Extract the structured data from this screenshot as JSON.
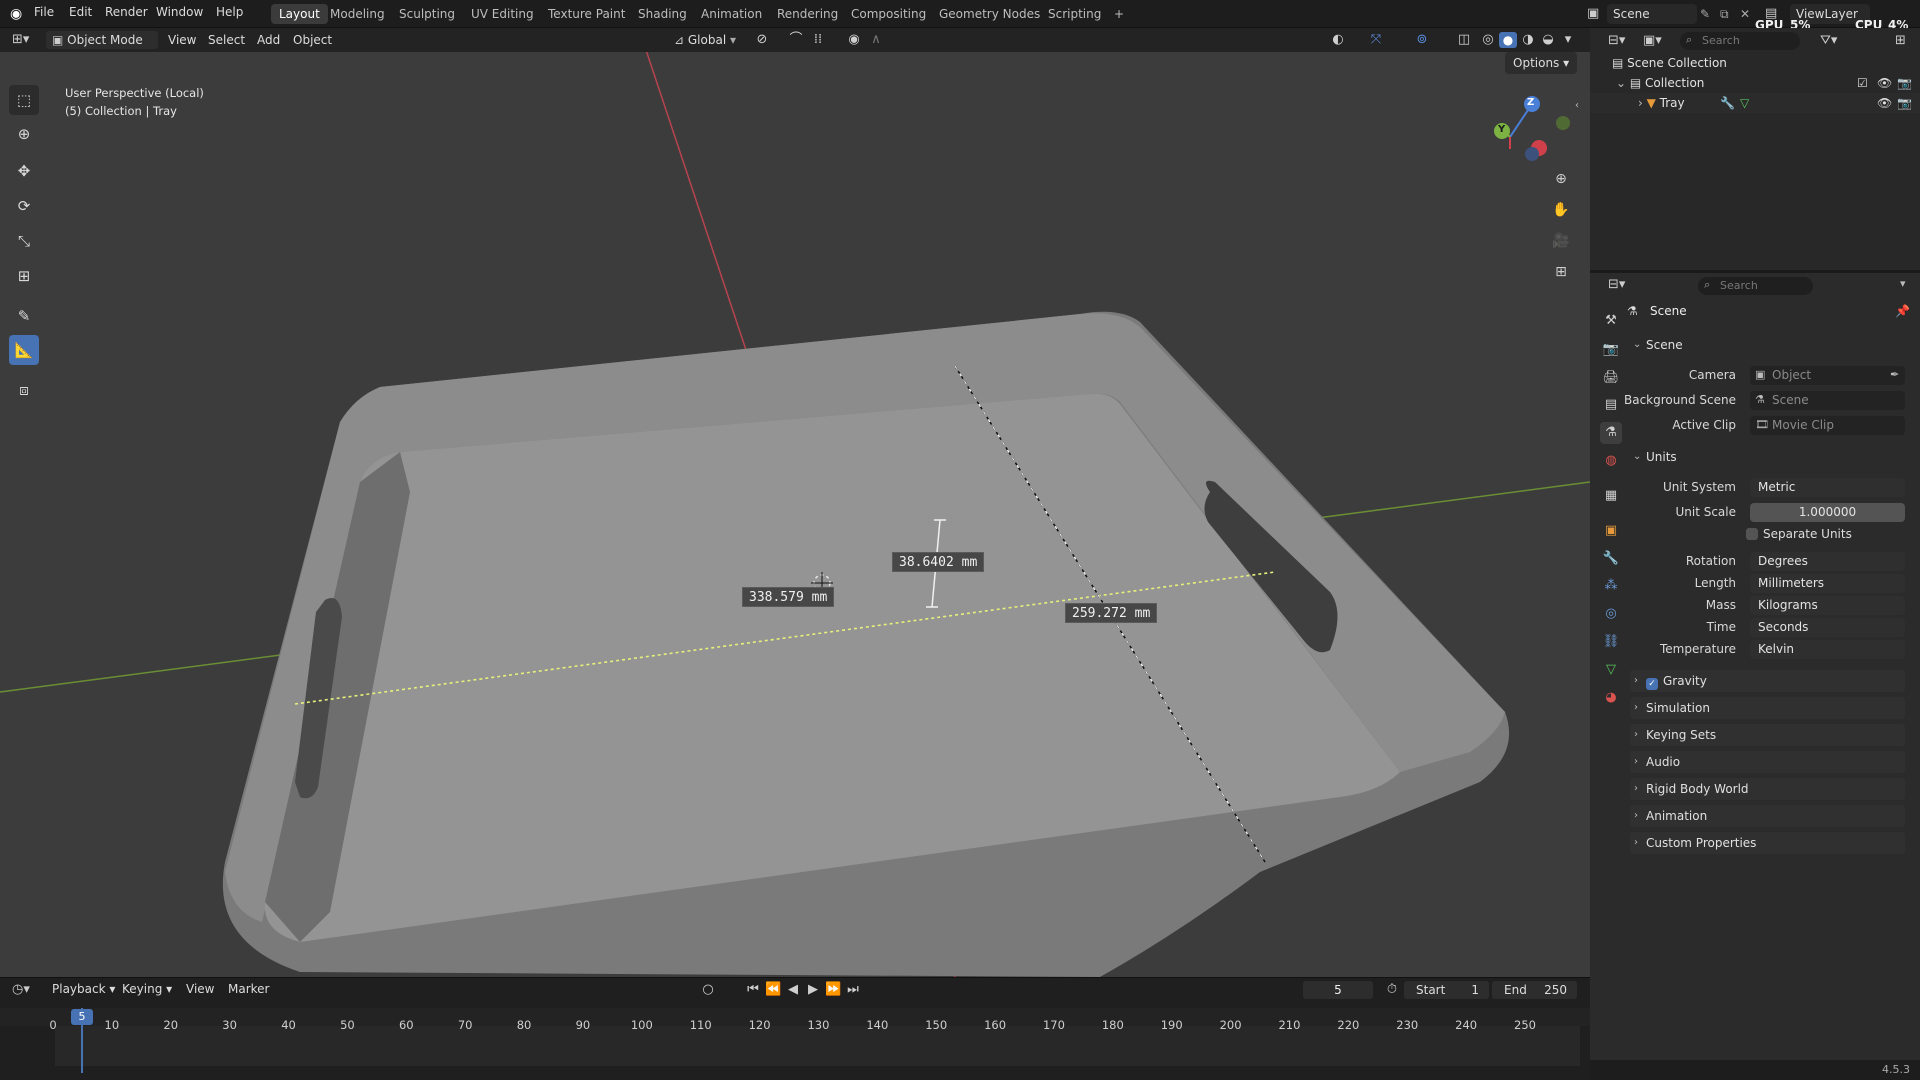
{
  "top_menu": [
    "File",
    "Edit",
    "Render",
    "Window",
    "Help"
  ],
  "workspaces": [
    "Layout",
    "Modeling",
    "Sculpting",
    "UV Editing",
    "Texture Paint",
    "Shading",
    "Animation",
    "Rendering",
    "Compositing",
    "Geometry Nodes",
    "Scripting"
  ],
  "active_workspace": "Layout",
  "add_workspace": "+",
  "scene_name": "Scene",
  "view_layer": "ViewLayer",
  "gpu_label": "GPU",
  "gpu_value": "5%",
  "cpu_label": "CPU",
  "cpu_value": "4%",
  "viewport_header": {
    "mode": "Object Mode",
    "menus": [
      "View",
      "Select",
      "Add",
      "Object"
    ],
    "orientation": "Global",
    "options": "Options"
  },
  "viewport": {
    "perspective": "User Perspective (Local)",
    "collection_info": "(5) Collection | Tray",
    "measurements": [
      "38.6402 mm",
      "338.579 mm",
      "259.272 mm"
    ],
    "gizmo_axes": [
      "Z",
      "Y"
    ]
  },
  "outliner": {
    "search_placeholder": "Search",
    "root": "Scene Collection",
    "collection": "Collection",
    "object": "Tray"
  },
  "properties": {
    "search_placeholder": "Search",
    "context": "Scene",
    "scene_section": "Scene",
    "camera_label": "Camera",
    "camera_value": "Object",
    "bg_scene_label": "Background Scene",
    "bg_scene_value": "Scene",
    "active_clip_label": "Active Clip",
    "active_clip_value": "Movie Clip",
    "units_section": "Units",
    "unit_system_label": "Unit System",
    "unit_system_value": "Metric",
    "unit_scale_label": "Unit Scale",
    "unit_scale_value": "1.000000",
    "separate_units": "Separate Units",
    "rotation_label": "Rotation",
    "rotation_value": "Degrees",
    "length_label": "Length",
    "length_value": "Millimeters",
    "mass_label": "Mass",
    "mass_value": "Kilograms",
    "time_label": "Time",
    "time_value": "Seconds",
    "temperature_label": "Temperature",
    "temperature_value": "Kelvin",
    "collapsed_sections": [
      "Gravity",
      "Simulation",
      "Keying Sets",
      "Audio",
      "Rigid Body World",
      "Animation",
      "Custom Properties"
    ]
  },
  "timeline": {
    "menus": [
      "Playback",
      "Keying",
      "View",
      "Marker"
    ],
    "current_frame": "5",
    "start_label": "Start",
    "start_value": "1",
    "end_label": "End",
    "end_value": "250",
    "ticks": [
      "0",
      "10",
      "20",
      "30",
      "40",
      "50",
      "60",
      "70",
      "80",
      "90",
      "100",
      "110",
      "120",
      "130",
      "140",
      "150",
      "160",
      "170",
      "180",
      "190",
      "200",
      "210",
      "220",
      "230",
      "240",
      "250"
    ]
  },
  "version": "4.5.3",
  "colors": {
    "accent": "#4772b3",
    "x_axis": "#d0404a",
    "y_axis": "#7cb342",
    "z_axis": "#4a7fd8"
  }
}
